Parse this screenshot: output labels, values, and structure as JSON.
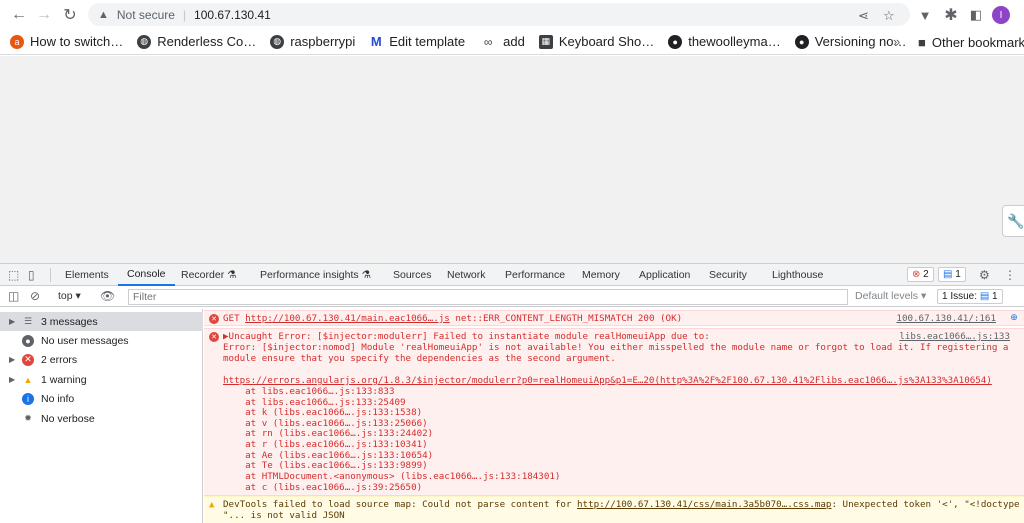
{
  "toolbar": {
    "security_label": "Not secure",
    "url": "100.67.130.41",
    "profile_initial": "I"
  },
  "bookmarks": [
    {
      "label": "How to switch…",
      "icon": "ask-icon",
      "color": "#e8560f"
    },
    {
      "label": "Renderless Co…",
      "icon": "globe-icon",
      "color": "#3c4043"
    },
    {
      "label": "raspberrypi",
      "icon": "globe-icon",
      "color": "#3c4043"
    },
    {
      "label": "Edit template",
      "icon": "m-icon",
      "color": "#2a4bd7"
    },
    {
      "label": "add",
      "icon": "glasses-icon",
      "color": "#3c4043"
    },
    {
      "label": "Keyboard Sho…",
      "icon": "keyboard-icon",
      "color": "#3c4043"
    },
    {
      "label": "thewoolleyma…",
      "icon": "github-icon",
      "color": "#202124"
    },
    {
      "label": "Versioning no…",
      "icon": "github-icon",
      "color": "#202124"
    }
  ],
  "bookmarks_other": "Other bookmarks",
  "devtools": {
    "tabs": [
      "Elements",
      "Console",
      "Recorder",
      "Performance insights",
      "Sources",
      "Network",
      "Performance",
      "Memory",
      "Application",
      "Security",
      "Lighthouse"
    ],
    "active_tab": "Console",
    "error_count": "2",
    "issue_count": "1",
    "context": "top",
    "filter_placeholder": "Filter",
    "levels": "Default levels",
    "issues_label": "1 Issue:",
    "issues_count": "1"
  },
  "sidebar": [
    {
      "label": "3 messages",
      "icon": "list-icon"
    },
    {
      "label": "No user messages",
      "icon": "user-icon"
    },
    {
      "label": "2 errors",
      "icon": "error-icon"
    },
    {
      "label": "1 warning",
      "icon": "warning-icon"
    },
    {
      "label": "No info",
      "icon": "info-icon"
    },
    {
      "label": "No verbose",
      "icon": "bug-icon"
    }
  ],
  "console": {
    "msg1": {
      "text_pre": "GET ",
      "link": "http://100.67.130.41/main.eac1066….js",
      "text_post": " net::ERR_CONTENT_LENGTH_MISMATCH 200 (OK)",
      "source": "100.67.130.41/:161"
    },
    "msg2": {
      "line1": "▶Uncaught Error: [$injector:modulerr] Failed to instantiate module realHomeuiApp due to:",
      "source": "libs.eac1066….js:133",
      "line2": "Error: [$injector:nomod] Module 'realHomeuiApp' is not available! You either misspelled the module name or forgot to load it. If registering a",
      "line3": "module ensure that you specify the dependencies as the second argument.",
      "url": "https://errors.angularjs.org/1.8.3/$injector/modulerr?p0=realHomeuiApp&p1=E…20(http%3A%2F%2F100.67.130.41%2Flibs.eac1066….js%3A133%3A10654)",
      "stack": [
        "    at libs.eac1066….js:133:833",
        "    at libs.eac1066….js:133:25409",
        "    at k (libs.eac1066….js:133:1538)",
        "    at v (libs.eac1066….js:133:25066)",
        "    at rn (libs.eac1066….js:133:24402)",
        "    at r (libs.eac1066….js:133:10341)",
        "    at Ae (libs.eac1066….js:133:10654)",
        "    at Te (libs.eac1066….js:133:9899)",
        "    at HTMLDocument.<anonymous> (libs.eac1066….js:133:184301)",
        "    at c (libs.eac1066….js:39:25650)"
      ]
    },
    "msg3": {
      "text_pre": "DevTools failed to load source map: Could not parse content for ",
      "link": "http://100.67.130.41/css/main.3a5b070….css.map",
      "text_post": ": Unexpected token '<', \"<!doctype",
      "line2": "\"... is not valid JSON"
    }
  }
}
